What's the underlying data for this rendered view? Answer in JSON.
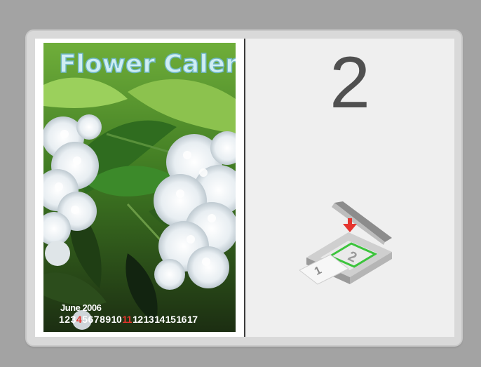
{
  "preview": {
    "left_page": {
      "calendar_title": "Flower Calend",
      "calendar_month": "June 2006",
      "calendar_days": [
        "1",
        "2",
        "3",
        "4",
        "5",
        "6",
        "7",
        "8",
        "9",
        "10",
        "11",
        "12",
        "13",
        "14",
        "15",
        "16",
        "17"
      ],
      "highlighted_days": [
        "4",
        "11"
      ],
      "highlight_color": "#e5352f"
    },
    "right_page": {
      "page_number": "2",
      "icon": "scanner-place-document-icon",
      "accent_color": "#3cc43c",
      "arrow_color": "#e5352f"
    }
  }
}
